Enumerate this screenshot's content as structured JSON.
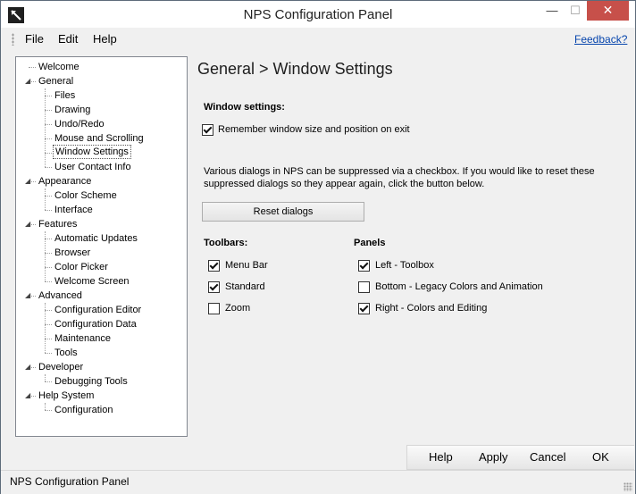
{
  "window": {
    "title": "NPS Configuration Panel",
    "status": "NPS Configuration Panel"
  },
  "titlebar_buttons": {
    "minimize": "—",
    "maximize": "☐",
    "close": "✕"
  },
  "menu": {
    "items": [
      "File",
      "Edit",
      "Help"
    ],
    "feedback": "Feedback?"
  },
  "tree": {
    "items": [
      {
        "label": "Welcome",
        "level": 0
      },
      {
        "label": "General",
        "level": 0
      },
      {
        "label": "Files",
        "level": 1
      },
      {
        "label": "Drawing",
        "level": 1
      },
      {
        "label": "Undo/Redo",
        "level": 1
      },
      {
        "label": "Mouse and Scrolling",
        "level": 1
      },
      {
        "label": "Window Settings",
        "level": 1,
        "selected": true
      },
      {
        "label": "User Contact Info",
        "level": 1
      },
      {
        "label": "Appearance",
        "level": 0
      },
      {
        "label": "Color Scheme",
        "level": 1
      },
      {
        "label": "Interface",
        "level": 1
      },
      {
        "label": "Features",
        "level": 0
      },
      {
        "label": "Automatic Updates",
        "level": 1
      },
      {
        "label": "Browser",
        "level": 1
      },
      {
        "label": "Color Picker",
        "level": 1
      },
      {
        "label": "Welcome Screen",
        "level": 1
      },
      {
        "label": "Advanced",
        "level": 0
      },
      {
        "label": "Configuration Editor",
        "level": 1
      },
      {
        "label": "Configuration Data",
        "level": 1
      },
      {
        "label": "Maintenance",
        "level": 1
      },
      {
        "label": "Tools",
        "level": 1
      },
      {
        "label": "Developer",
        "level": 0
      },
      {
        "label": "Debugging Tools",
        "level": 1
      },
      {
        "label": "Help System",
        "level": 0
      },
      {
        "label": "Configuration",
        "level": 1
      }
    ]
  },
  "main": {
    "heading": "General > Window Settings",
    "window_settings_label": "Window settings:",
    "remember_label": "Remember window size and position on exit",
    "remember_checked": true,
    "info_line1": "Various dialogs in NPS can be suppressed via a checkbox. If you would like to reset these",
    "info_line2": "suppressed dialogs so they appear again, click the button below.",
    "reset_button": "Reset dialogs",
    "toolbars_label": "Toolbars:",
    "toolbars": [
      {
        "label": "Menu Bar",
        "checked": true
      },
      {
        "label": "Standard",
        "checked": true
      },
      {
        "label": "Zoom",
        "checked": false
      }
    ],
    "panels_label": "Panels",
    "panels": [
      {
        "label": "Left - Toolbox",
        "checked": true
      },
      {
        "label": "Bottom - Legacy Colors and Animation",
        "checked": false
      },
      {
        "label": "Right - Colors and Editing",
        "checked": true
      }
    ]
  },
  "buttons": {
    "help": "Help",
    "apply": "Apply",
    "cancel": "Cancel",
    "ok": "OK"
  }
}
